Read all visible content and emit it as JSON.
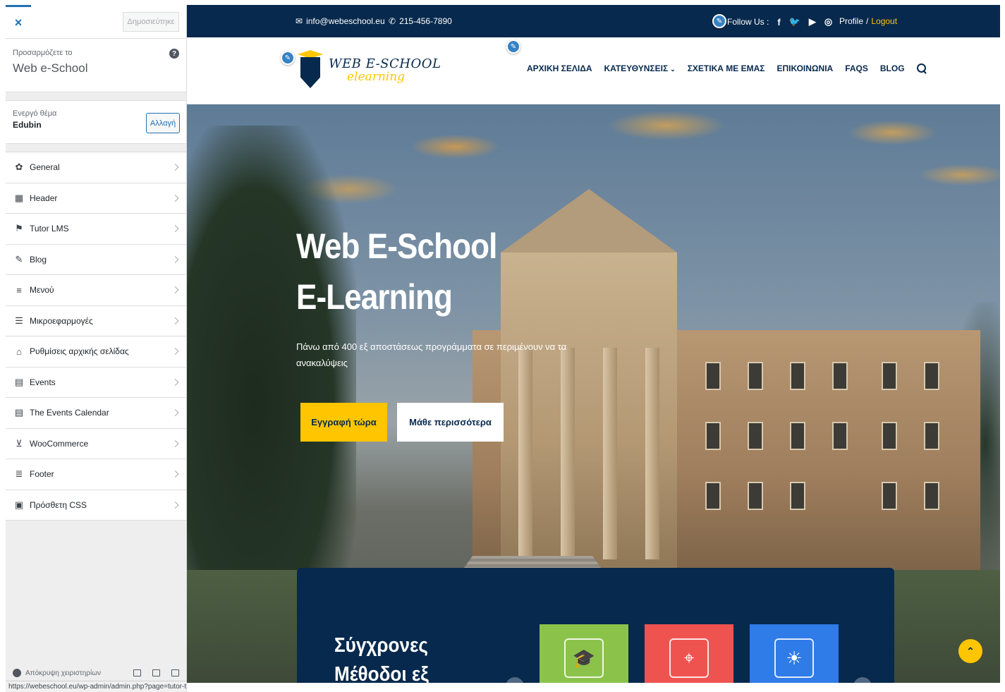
{
  "customizer": {
    "close_label": "×",
    "publish_label": "Δημοσιεύτηκε",
    "customizing_label": "Προσαρμόζετε το",
    "site_name": "Web e-School",
    "help_icon": "help-icon",
    "active_theme_label": "Ενεργό θέμα",
    "active_theme_name": "Edubin",
    "change_button": "Αλλαγή",
    "menu": [
      {
        "label": "General",
        "icon": "gear-icon"
      },
      {
        "label": "Header",
        "icon": "table-icon"
      },
      {
        "label": "Tutor LMS",
        "icon": "graduation-cap-icon"
      },
      {
        "label": "Blog",
        "icon": "edit-icon"
      },
      {
        "label": "Μενού",
        "icon": "menu-icon"
      },
      {
        "label": "Μικροεφαρμογές",
        "icon": "widgets-icon"
      },
      {
        "label": "Ρυθμίσεις αρχικής σελίδας",
        "icon": "home-icon"
      },
      {
        "label": "Events",
        "icon": "calendar-icon"
      },
      {
        "label": "The Events Calendar",
        "icon": "calendar-icon"
      },
      {
        "label": "WooCommerce",
        "icon": "cart-icon"
      },
      {
        "label": "Footer",
        "icon": "footer-icon"
      },
      {
        "label": "Πρόσθετη CSS",
        "icon": "css-icon"
      }
    ],
    "collapse_label": "Απόκρυψη χειριστηρίων",
    "status_url": "https://webeschool.eu/wp-admin/admin.php?page=tutor-tools"
  },
  "site": {
    "topbar": {
      "email": "info@webeschool.eu",
      "phone": "215-456-7890",
      "follow_label": "Follow Us :",
      "social": [
        "f",
        "🐦",
        "▶",
        "◎"
      ],
      "profile": "Profile",
      "separator": "/",
      "logout": "Logout"
    },
    "logo": {
      "line1": "WEB E-SCHOOL",
      "line2": "elearning"
    },
    "nav": {
      "home": "ΑΡΧΙΚΗ ΣΕΛΙΔΑ",
      "categories": "ΚΑΤΕΥΘΥΝΣΕΙΣ",
      "about": "ΣΧΕΤΙΚΑ ΜΕ ΕΜΑΣ",
      "contact": "ΕΠΙΚΟΙΝΩΝΙΑ",
      "faqs": "FAQS",
      "blog": "BLOG"
    },
    "hero": {
      "title_line1": "Web E-School",
      "title_line2": "E-Learning",
      "subtitle": "Πάνω από 400 εξ αποστάσεως προγράμματα σε περιμένουν να τα ανακαλύψεις",
      "primary_button": "Εγγραφή τώρα",
      "secondary_button": "Μάθε περισσότερα"
    },
    "features": {
      "title_line1": "Σύγχρονες",
      "title_line2": "Μέθοδοι εξ",
      "cards": [
        {
          "icon": "graduation-cap-icon",
          "color": "#8bc34a"
        },
        {
          "icon": "location-pin-icon",
          "color": "#ef5350"
        },
        {
          "icon": "lightbulb-icon",
          "color": "#2f7be8"
        }
      ]
    },
    "colors": {
      "navy": "#07294d",
      "accent": "#ffc600",
      "wp_blue": "#2271b1"
    }
  }
}
